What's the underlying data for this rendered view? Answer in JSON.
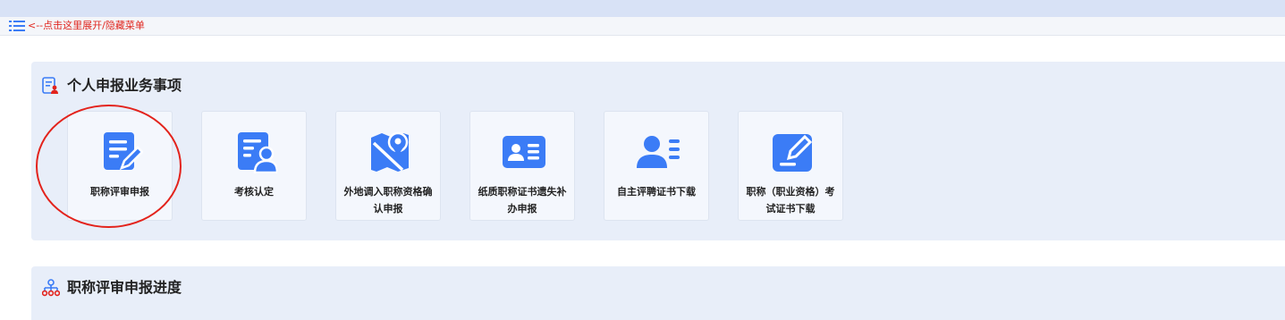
{
  "menu": {
    "toggle_text": "<--点击这里展开/隐藏菜单",
    "icon": "list-icon"
  },
  "section_personal": {
    "title": "个人申报业务事项",
    "icon": "personal-document-icon",
    "tiles": [
      {
        "label": "职称评审申报",
        "icon": "edit-document-icon"
      },
      {
        "label": "考核认定",
        "icon": "user-document-icon"
      },
      {
        "label": "外地调入职称资格确认申报",
        "icon": "map-pin-icon"
      },
      {
        "label": "纸质职称证书遗失补办申报",
        "icon": "id-card-icon"
      },
      {
        "label": "自主评聘证书下载",
        "icon": "user-list-icon"
      },
      {
        "label": "职称（职业资格）考试证书下载",
        "icon": "pen-square-icon"
      }
    ]
  },
  "section_progress": {
    "title": "职称评审申报进度",
    "icon": "org-chart-icon"
  },
  "colors": {
    "accent_blue": "#3b7cf6",
    "highlight_red": "#e3231c",
    "panel_bg": "#e8eef9",
    "topbar_bg": "#d8e2f6"
  }
}
